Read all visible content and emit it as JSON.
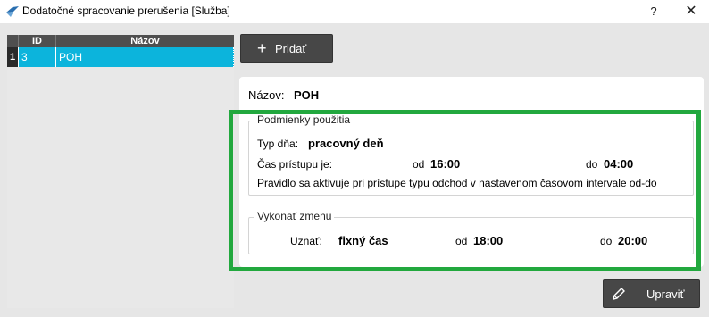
{
  "window": {
    "title": "Dodatočné spracovanie prerušenia [Služba]",
    "help_label": "?",
    "close_label": "✕"
  },
  "grid": {
    "columns": [
      "ID",
      "Názov"
    ],
    "rows": [
      {
        "num": "1",
        "id": "3",
        "name": "POH"
      }
    ]
  },
  "add_button": {
    "icon": "plus-icon",
    "label": "Pridať"
  },
  "detail": {
    "name_label": "Názov:",
    "name_value": "POH",
    "conditions": {
      "title": "Podmienky použitia",
      "day_type_label": "Typ dňa:",
      "day_type_value": "pracovný deň",
      "access_time_label": "Čas prístupu je:",
      "from_label": "od",
      "from_value": "16:00",
      "to_label": "do",
      "to_value": "04:00",
      "rule_text": "Pravidlo sa aktivuje pri prístupe typu odchod v nastavenom časovom intervale od-do"
    },
    "execute": {
      "title": "Vykonať zmenu",
      "recognize_label": "Uznať:",
      "recognize_value": "fixný čas",
      "from_label": "od",
      "from_value": "18:00",
      "to_label": "do",
      "to_value": "20:00"
    }
  },
  "edit_button": {
    "icon": "pencil-icon",
    "label": "Upraviť"
  },
  "colors": {
    "selection": "#0cb4dc",
    "button_dark": "#474747",
    "highlight_border": "#22a83e"
  }
}
